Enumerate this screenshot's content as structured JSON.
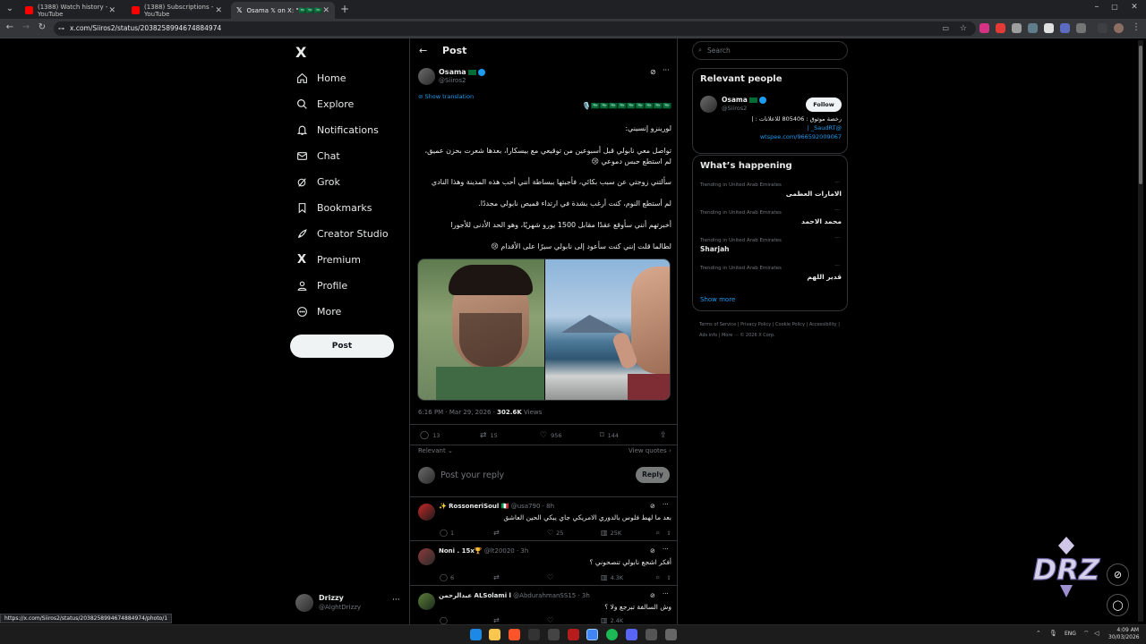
{
  "browser": {
    "tabs": [
      {
        "title": "(1388) Watch history - YouTube",
        "color": "#ff0000"
      },
      {
        "title": "(1388) Subscriptions - YouTube",
        "color": "#ff0000"
      },
      {
        "title": "Osama 𝕏 on X: \"🇸🇦🇸🇦🇸🇦🇸🇦🇸🇦🇸🇦",
        "color": "#ffffff"
      }
    ],
    "url": "x.com/Siiros2/status/2038258994674884974",
    "status_url": "https://x.com/Siiros2/status/2038258994674884974/photo/1"
  },
  "sidebar": {
    "logo": "X",
    "items": [
      {
        "label": "Home",
        "icon": "home-icon"
      },
      {
        "label": "Explore",
        "icon": "search-icon"
      },
      {
        "label": "Notifications",
        "icon": "bell-icon"
      },
      {
        "label": "Chat",
        "icon": "mail-icon"
      },
      {
        "label": "Grok",
        "icon": "grok-icon"
      },
      {
        "label": "Bookmarks",
        "icon": "bookmark-icon"
      },
      {
        "label": "Creator Studio",
        "icon": "rocket-icon"
      },
      {
        "label": "Premium",
        "icon": "x-icon"
      },
      {
        "label": "Profile",
        "icon": "person-icon"
      },
      {
        "label": "More",
        "icon": "more-circle-icon"
      }
    ],
    "post_button": "Post",
    "account": {
      "name": "Drizzy",
      "handle": "@AlghtDrizzy"
    }
  },
  "post": {
    "header": "Post",
    "author": {
      "name": "Osama",
      "handle": "@Siiros2"
    },
    "show_translation": "Show translation",
    "flags_line": "🇸🇦🇸🇦🇸🇦🇸🇦🇸🇦🇸🇦🇸🇦🇸🇦🇸🇦🎙️",
    "lines": [
      "لورينزو إنسيني:",
      "تواصل معي نابولي قبل أسبوعين من توقيعي مع بيسكارا، بعدها شعرت بحزن عميق، لم استطع حبس دموعي 😢",
      "سألتني زوجتي عن سبب بكائي، فأجبتها ببساطة أنني أحب هذه المدينة وهذا النادي",
      "لم أستطع النوم، كنت أرغب بشدة في ارتداء قميص نابولي مجددًا.",
      "أخبرتهم أنني سأوقع عقدًا مقابل 1500 يورو شهريًا، وهو الحد الأدنى للأجورا",
      "لطالما قلت إنني كنت سأعود إلى نابولي سيرًا على الأقدام 😢"
    ],
    "timestamp": "6:16 PM · Mar 29, 2026 · ",
    "views_count": "302.6K",
    "views_label": "Views",
    "stats": {
      "replies": "13",
      "reposts": "15",
      "likes": "956",
      "bookmarks": "144"
    },
    "relevant": "Relevant",
    "view_quotes": "View quotes",
    "reply_placeholder": "Post your reply",
    "reply_button": "Reply"
  },
  "replies": [
    {
      "name": "✨ RossoneriSoul 🇮🇹",
      "handle": "@usa790 · 8h",
      "text": "بعد ما لهط فلوس بالدوري الامريكي جاي يبكي الحين العاشق",
      "stats": {
        "replies": "1",
        "reposts": "",
        "likes": "25",
        "views": "25K"
      }
    },
    {
      "name": "Noni . 15x🏆",
      "handle": "@lt20020 · 3h",
      "text": "أفكر اشجع نابولي تنصحوني ؟",
      "stats": {
        "replies": "6",
        "reposts": "",
        "likes": "",
        "views": "4.3K"
      }
    },
    {
      "name": "عبدالرحمن ALSolami l",
      "handle": "@AbdurahmanSS15 · 3h",
      "text": "وش السالفة تبرجع ولا ؟",
      "stats": {
        "replies": "",
        "reposts": "",
        "likes": "",
        "views": "2.4K"
      }
    }
  ],
  "right": {
    "search_placeholder": "Search",
    "relevant_title": "Relevant people",
    "person": {
      "name": "Osama",
      "handle": "@Siiros2",
      "follow": "Follow",
      "bio_line1": "رخصة موثوق : 805406 للاعلانات : |",
      "bio_line2": "@SaudRT_ |",
      "bio_line3": "wtspee.com/966592009067"
    },
    "happening_title": "What’s happening",
    "trends": [
      {
        "meta": "Trending in United Arab Emirates",
        "name": "الامارات العظمى"
      },
      {
        "meta": "Trending in United Arab Emirates",
        "name": "محمد الاحمد"
      },
      {
        "meta": "Trending in United Arab Emirates",
        "name": "Sharjah"
      },
      {
        "meta": "Trending in United Arab Emirates",
        "name": "قدير اللهم"
      }
    ],
    "show_more": "Show more",
    "footer": [
      "Terms of Service",
      "|",
      "Privacy Policy",
      "|",
      "Cookie Policy",
      "|",
      "Accessibility",
      "|",
      "Ads info",
      "|",
      "More ···",
      "© 2026 X Corp."
    ]
  },
  "taskbar": {
    "lang": "ENG",
    "time": "4:09 AM",
    "date": "30/03/2026"
  }
}
